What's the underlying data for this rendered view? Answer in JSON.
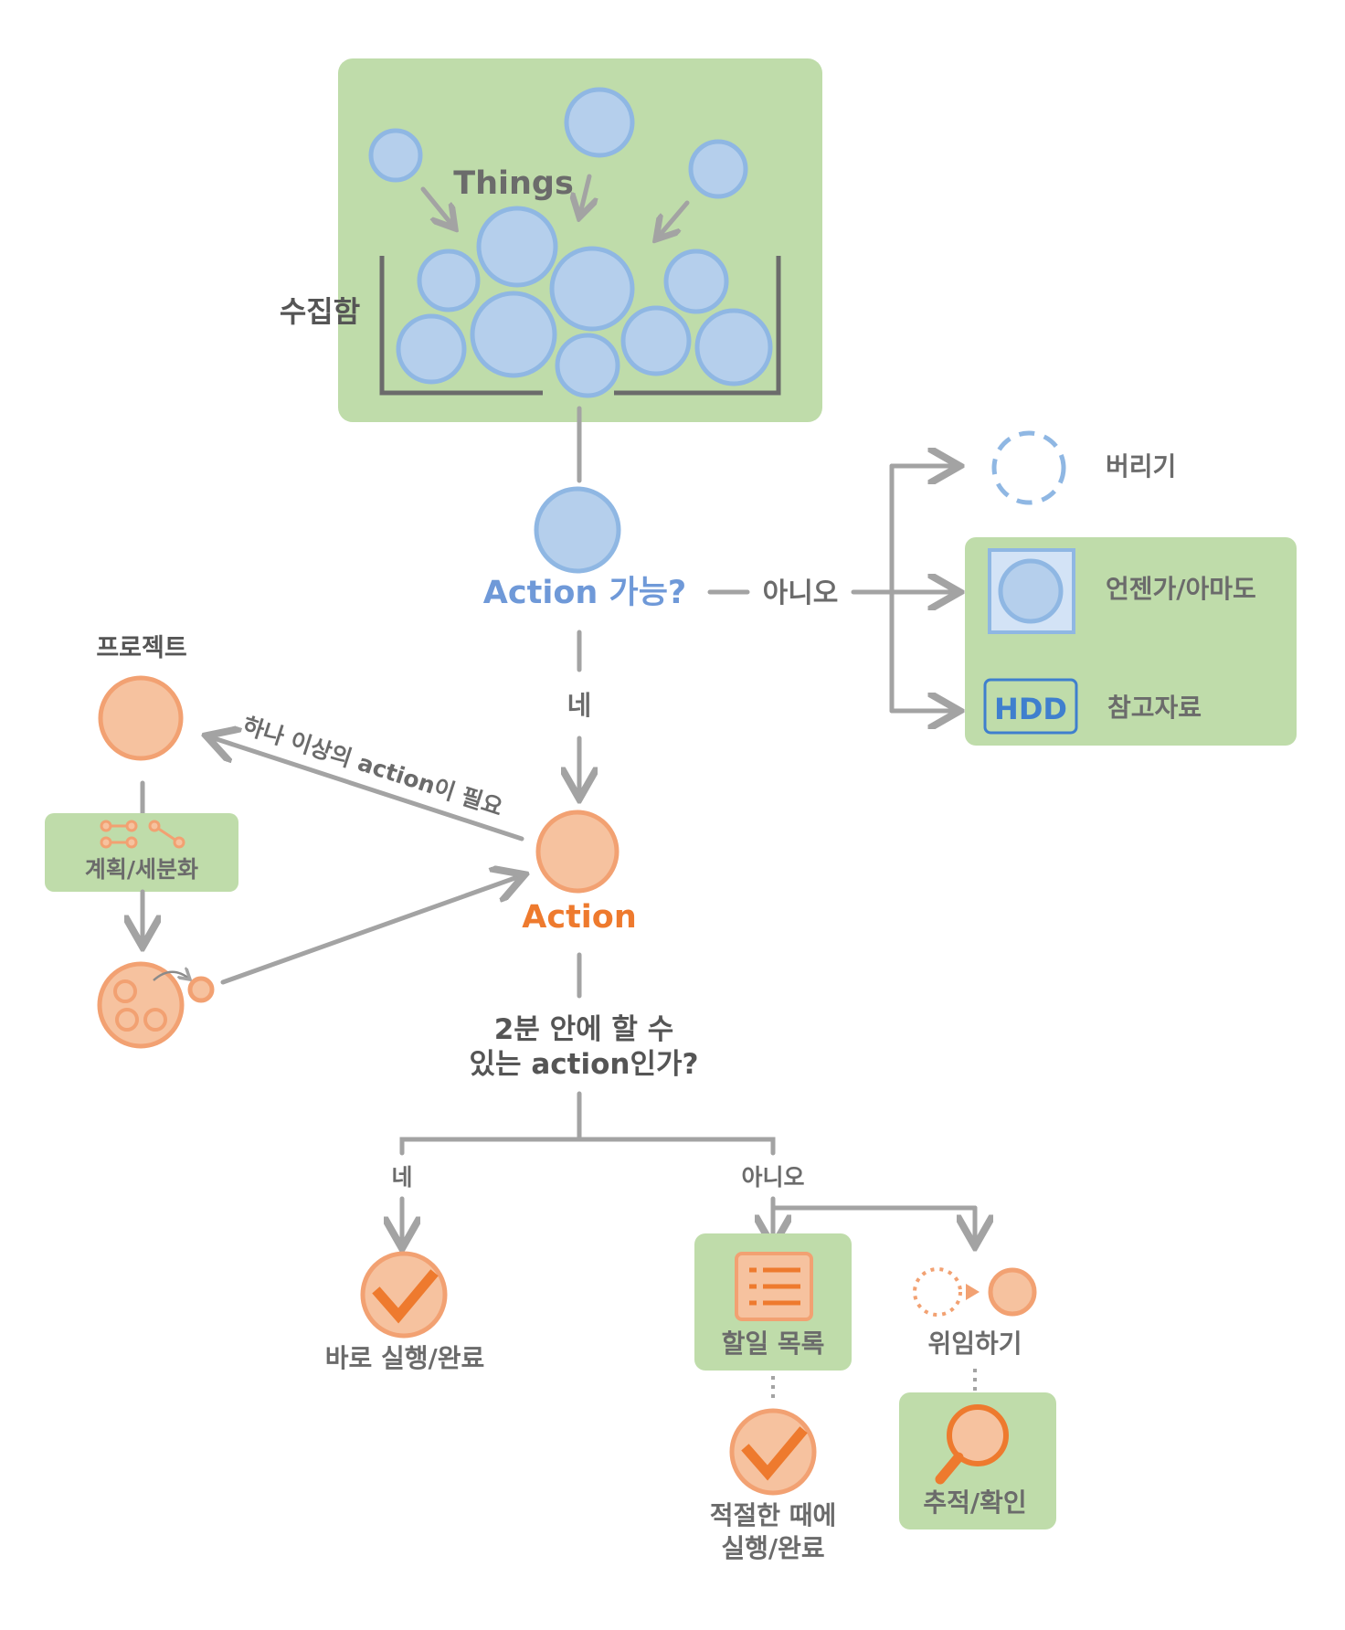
{
  "colors": {
    "green_box": "#bfdcaa",
    "blue_bubble": "#b5cfec",
    "blue_text": "#6f99d8",
    "orange_bubble": "#f6c29f",
    "orange_text": "#ee7a2e",
    "arrow_gray": "#a3a3a3",
    "label_gray": "#6b6b6b"
  },
  "inbox": {
    "things_label": "Things",
    "label": "수집함"
  },
  "decision_actionable": {
    "question": "Action 가능?",
    "yes": "네",
    "no": "아니오"
  },
  "non_actionable": {
    "trash": "버리기",
    "someday": "언젠가/아마도",
    "reference_icon": "HDD",
    "reference": "참고자료"
  },
  "project": {
    "label": "프로젝트",
    "needs_more": "하나 이상의 action이 필요",
    "plan": "계획/세분화"
  },
  "action": {
    "label": "Action"
  },
  "two_minute": {
    "line1": "2분 안에 할 수",
    "line2": "있는 action인가?",
    "yes": "네",
    "no": "아니오"
  },
  "outcomes": {
    "do_now": "바로 실행/완료",
    "todo_list": "할일 목록",
    "do_later_line1": "적절한 때에",
    "do_later_line2": "실행/완료",
    "delegate": "위임하기",
    "track": "추적/확인"
  },
  "icons": [
    "trash-dashed-circle-icon",
    "someday-box-icon",
    "hdd-icon",
    "plan-nodes-icon",
    "subactions-bubble-icon",
    "check-icon",
    "list-icon",
    "delegate-icon",
    "magnifier-icon"
  ]
}
